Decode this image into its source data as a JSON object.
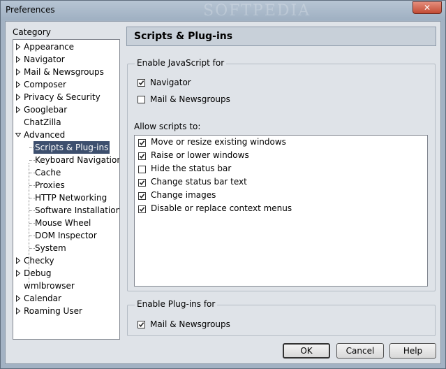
{
  "window": {
    "title": "Preferences",
    "watermark": "SOFTPEDIA",
    "close_glyph": "✕"
  },
  "category": {
    "label": "Category",
    "items": [
      {
        "label": "Appearance",
        "expander": "collapsed",
        "level": 0
      },
      {
        "label": "Navigator",
        "expander": "collapsed",
        "level": 0
      },
      {
        "label": "Mail & Newsgroups",
        "expander": "collapsed",
        "level": 0
      },
      {
        "label": "Composer",
        "expander": "collapsed",
        "level": 0
      },
      {
        "label": "Privacy & Security",
        "expander": "collapsed",
        "level": 0
      },
      {
        "label": "Googlebar",
        "expander": "collapsed",
        "level": 0
      },
      {
        "label": "ChatZilla",
        "expander": "none",
        "level": 0
      },
      {
        "label": "Advanced",
        "expander": "expanded",
        "level": 0
      },
      {
        "label": "Scripts & Plug-ins",
        "expander": "none",
        "level": 1,
        "selected": true
      },
      {
        "label": "Keyboard Navigation",
        "expander": "none",
        "level": 1
      },
      {
        "label": "Cache",
        "expander": "none",
        "level": 1
      },
      {
        "label": "Proxies",
        "expander": "none",
        "level": 1
      },
      {
        "label": "HTTP Networking",
        "expander": "none",
        "level": 1
      },
      {
        "label": "Software Installation",
        "expander": "none",
        "level": 1
      },
      {
        "label": "Mouse Wheel",
        "expander": "none",
        "level": 1
      },
      {
        "label": "DOM Inspector",
        "expander": "none",
        "level": 1
      },
      {
        "label": "System",
        "expander": "none",
        "level": 1
      },
      {
        "label": "Checky",
        "expander": "collapsed",
        "level": 0
      },
      {
        "label": "Debug",
        "expander": "collapsed",
        "level": 0
      },
      {
        "label": "wmlbrowser",
        "expander": "none",
        "level": 0
      },
      {
        "label": "Calendar",
        "expander": "collapsed",
        "level": 0
      },
      {
        "label": "Roaming User",
        "expander": "collapsed",
        "level": 0
      }
    ]
  },
  "panel": {
    "title": "Scripts & Plug-ins",
    "enable_js": {
      "legend": "Enable JavaScript for",
      "options": [
        {
          "label": "Navigator",
          "checked": true
        },
        {
          "label": "Mail & Newsgroups",
          "checked": false
        }
      ]
    },
    "allow_scripts": {
      "label": "Allow scripts to:",
      "options": [
        {
          "label": "Move or resize existing windows",
          "checked": true
        },
        {
          "label": "Raise or lower windows",
          "checked": true
        },
        {
          "label": "Hide the status bar",
          "checked": false
        },
        {
          "label": "Change status bar text",
          "checked": true
        },
        {
          "label": "Change images",
          "checked": true
        },
        {
          "label": "Disable or replace context menus",
          "checked": true
        }
      ]
    },
    "enable_plugins": {
      "legend": "Enable Plug-ins for",
      "options": [
        {
          "label": "Mail & Newsgroups",
          "checked": true
        }
      ]
    }
  },
  "buttons": {
    "ok": "OK",
    "cancel": "Cancel",
    "help": "Help"
  }
}
